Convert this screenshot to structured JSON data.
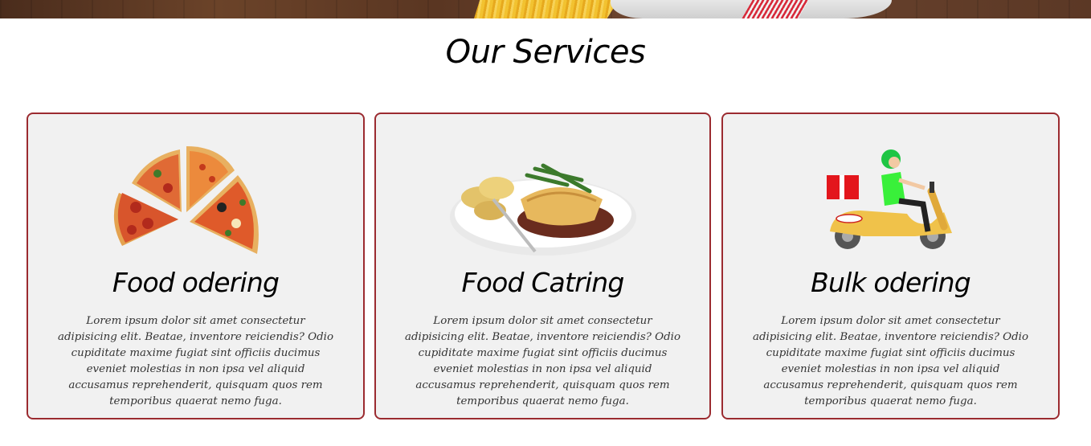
{
  "section": {
    "title": "Our Services"
  },
  "services": [
    {
      "title": "Food odering",
      "image_icon": "pizza-slices-icon",
      "description": "Lorem ipsum dolor sit amet consectetur adipisicing elit. Beatae, inventore reiciendis? Odio cupiditate maxime fugiat sint officiis ducimus eveniet molestias in non ipsa vel aliquid accusamus reprehenderit, quisquam quos rem temporibus quaerat nemo fuga."
    },
    {
      "title": "Food Catring",
      "image_icon": "plated-meal-icon",
      "description": "Lorem ipsum dolor sit amet consectetur adipisicing elit. Beatae, inventore reiciendis? Odio cupiditate maxime fugiat sint officiis ducimus eveniet molestias in non ipsa vel aliquid accusamus reprehenderit, quisquam quos rem temporibus quaerat nemo fuga."
    },
    {
      "title": "Bulk odering",
      "image_icon": "delivery-scooter-icon",
      "description": "Lorem ipsum dolor sit amet consectetur adipisicing elit. Beatae, inventore reiciendis? Odio cupiditate maxime fugiat sint officiis ducimus eveniet molestias in non ipsa vel aliquid accusamus reprehenderit, quisquam quos rem temporibus quaerat nemo fuga."
    }
  ],
  "colors": {
    "card_border": "#9b2b30",
    "card_background": "#f1f1f1"
  }
}
